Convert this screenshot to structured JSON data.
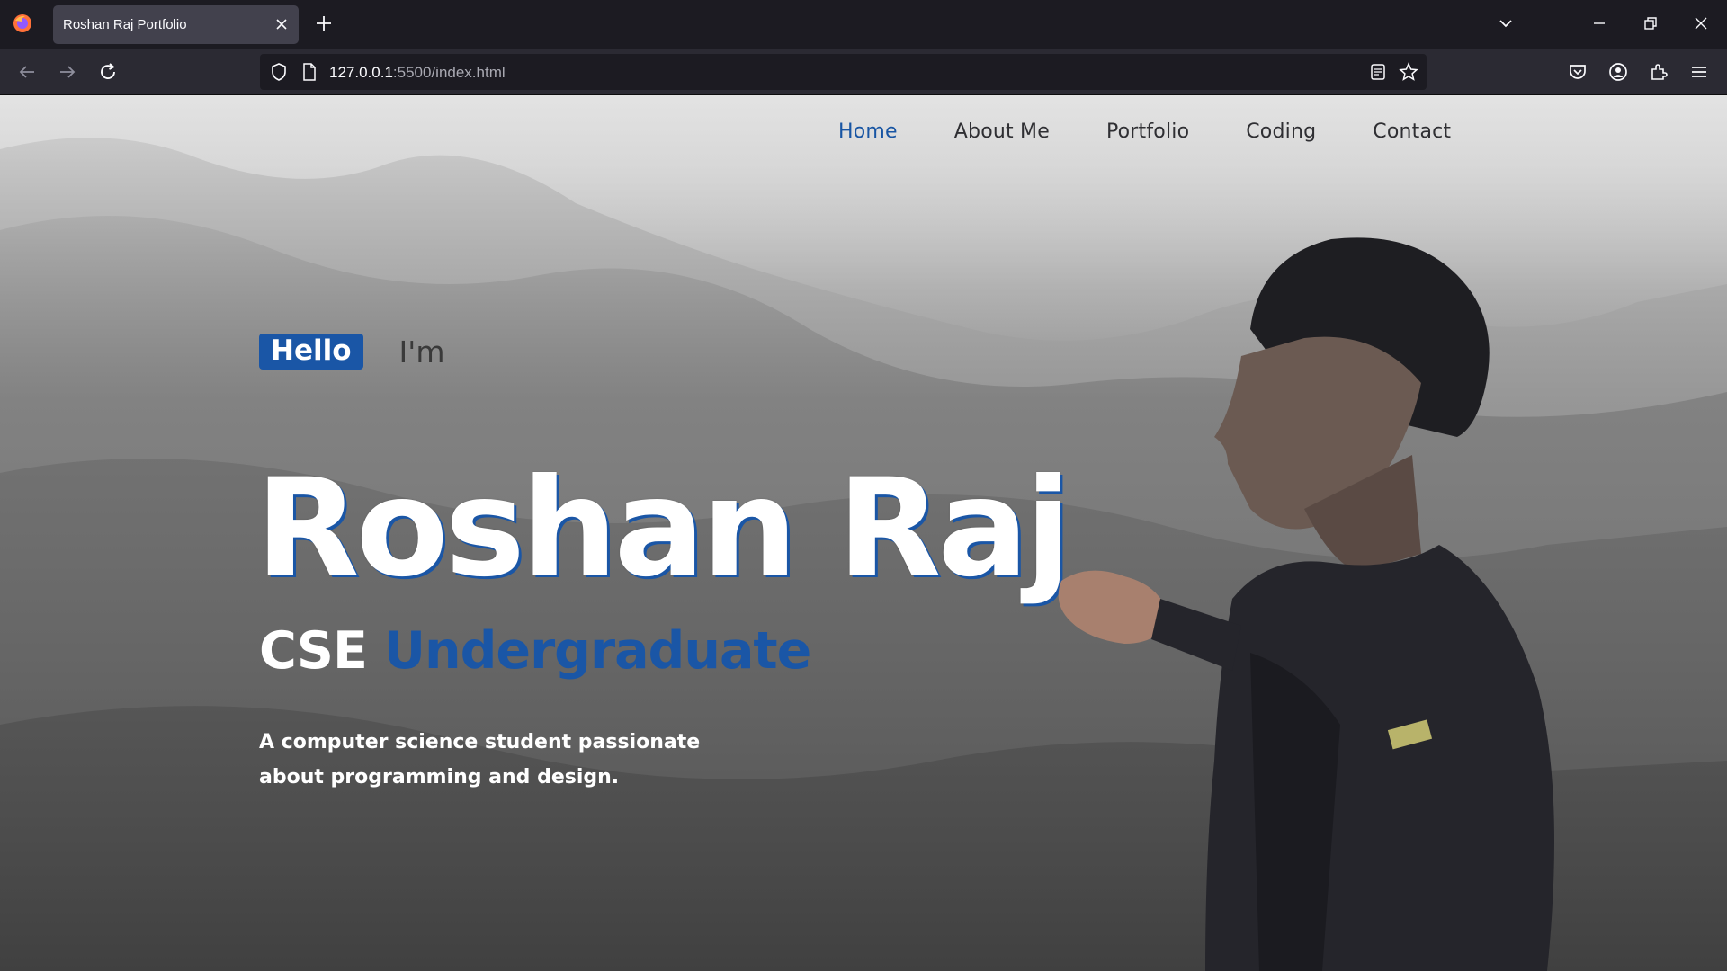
{
  "browser": {
    "tab_title": "Roshan Raj Portfolio",
    "url_host": "127.0.0.1",
    "url_rest": ":5500/index.html"
  },
  "site": {
    "nav": [
      {
        "label": "Home",
        "active": true
      },
      {
        "label": "About Me",
        "active": false
      },
      {
        "label": "Portfolio",
        "active": false
      },
      {
        "label": "Coding",
        "active": false
      },
      {
        "label": "Contact",
        "active": false
      }
    ],
    "hero": {
      "hello": "Hello",
      "im": "I'm",
      "name": "Roshan Raj",
      "subtitle_part1": "CSE",
      "subtitle_part2": "Undergraduate",
      "tagline": "A computer science student passionate about programming and design."
    },
    "colors": {
      "accent": "#1a56a6",
      "nav_active": "#1855a3"
    }
  }
}
